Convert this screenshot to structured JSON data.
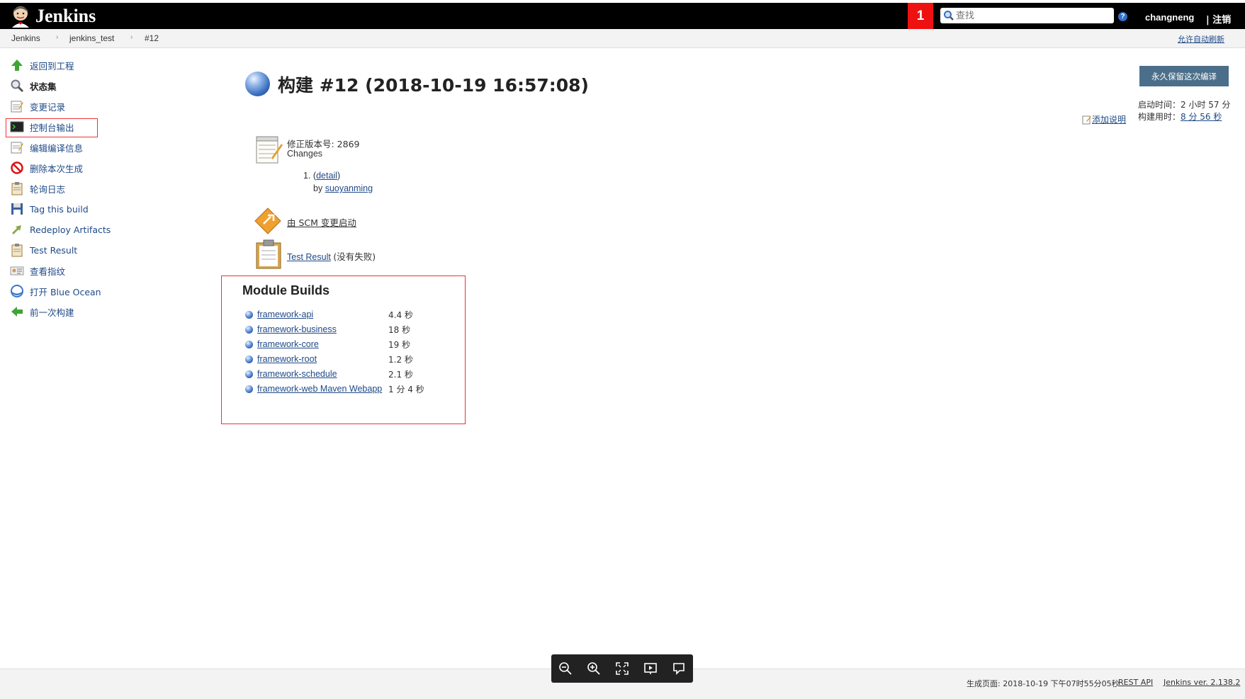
{
  "header": {
    "logo_text": "Jenkins",
    "alert_count": "1",
    "search_placeholder": "查找",
    "help": "?",
    "username": "changneng",
    "logout_label": "| 注销"
  },
  "breadcrumb": {
    "items": [
      "Jenkins",
      "jenkins_test",
      "#12"
    ],
    "auto_refresh": "允许自动刷新"
  },
  "sidebar": {
    "items": [
      {
        "label": "返回到工程",
        "icon": "up-arrow-icon"
      },
      {
        "label": "状态集",
        "icon": "search-icon"
      },
      {
        "label": "变更记录",
        "icon": "notepad-icon"
      },
      {
        "label": "控制台输出",
        "icon": "terminal-icon"
      },
      {
        "label": "编辑编译信息",
        "icon": "notepad-icon"
      },
      {
        "label": "删除本次生成",
        "icon": "no-entry-icon"
      },
      {
        "label": "轮询日志",
        "icon": "clipboard-icon"
      },
      {
        "label": "Tag this build",
        "icon": "save-icon"
      },
      {
        "label": "Redeploy Artifacts",
        "icon": "redeploy-icon"
      },
      {
        "label": "Test Result",
        "icon": "clipboard-icon"
      },
      {
        "label": "查看指纹",
        "icon": "fingerprint-icon"
      },
      {
        "label": "打开 Blue Ocean",
        "icon": "blue-ocean-icon"
      },
      {
        "label": "前一次构建",
        "icon": "left-arrow-icon"
      }
    ]
  },
  "main": {
    "title": "构建 #12 (2018-10-19 16:57:08)",
    "keep_button": "永久保留这次编译",
    "started_label": "启动时间：",
    "started_value": "2 小时 57 分",
    "duration_label": "构建用时：",
    "duration_value": "8 分 56 秒",
    "add_description": "添加说明",
    "revision_label": "修正版本号: 2869",
    "changes_label": "Changes",
    "change_index": "1.",
    "change_detail": "detail",
    "change_by": "by",
    "change_author": "suoyanming",
    "scm_cause": "由 SCM 变更启动",
    "test_result_link": "Test Result",
    "test_result_note": "(没有失败)"
  },
  "modules": {
    "title": "Module Builds",
    "rows": [
      {
        "name": "framework-api",
        "duration": "4.4 秒"
      },
      {
        "name": "framework-business",
        "duration": "18 秒"
      },
      {
        "name": "framework-core",
        "duration": "19 秒"
      },
      {
        "name": "framework-root",
        "duration": "1.2 秒"
      },
      {
        "name": "framework-schedule",
        "duration": "2.1 秒"
      },
      {
        "name": "framework-web Maven Webapp",
        "duration": "1 分 4 秒"
      }
    ]
  },
  "footer": {
    "generated": "生成页面: 2018-10-19 下午07时55分05秒",
    "rest_api": "REST API",
    "version": "Jenkins ver. 2.138.2"
  },
  "viewer_toolbar": [
    "zoom-out-icon",
    "zoom-in-icon",
    "fullscreen-icon",
    "present-icon",
    "comment-icon"
  ]
}
